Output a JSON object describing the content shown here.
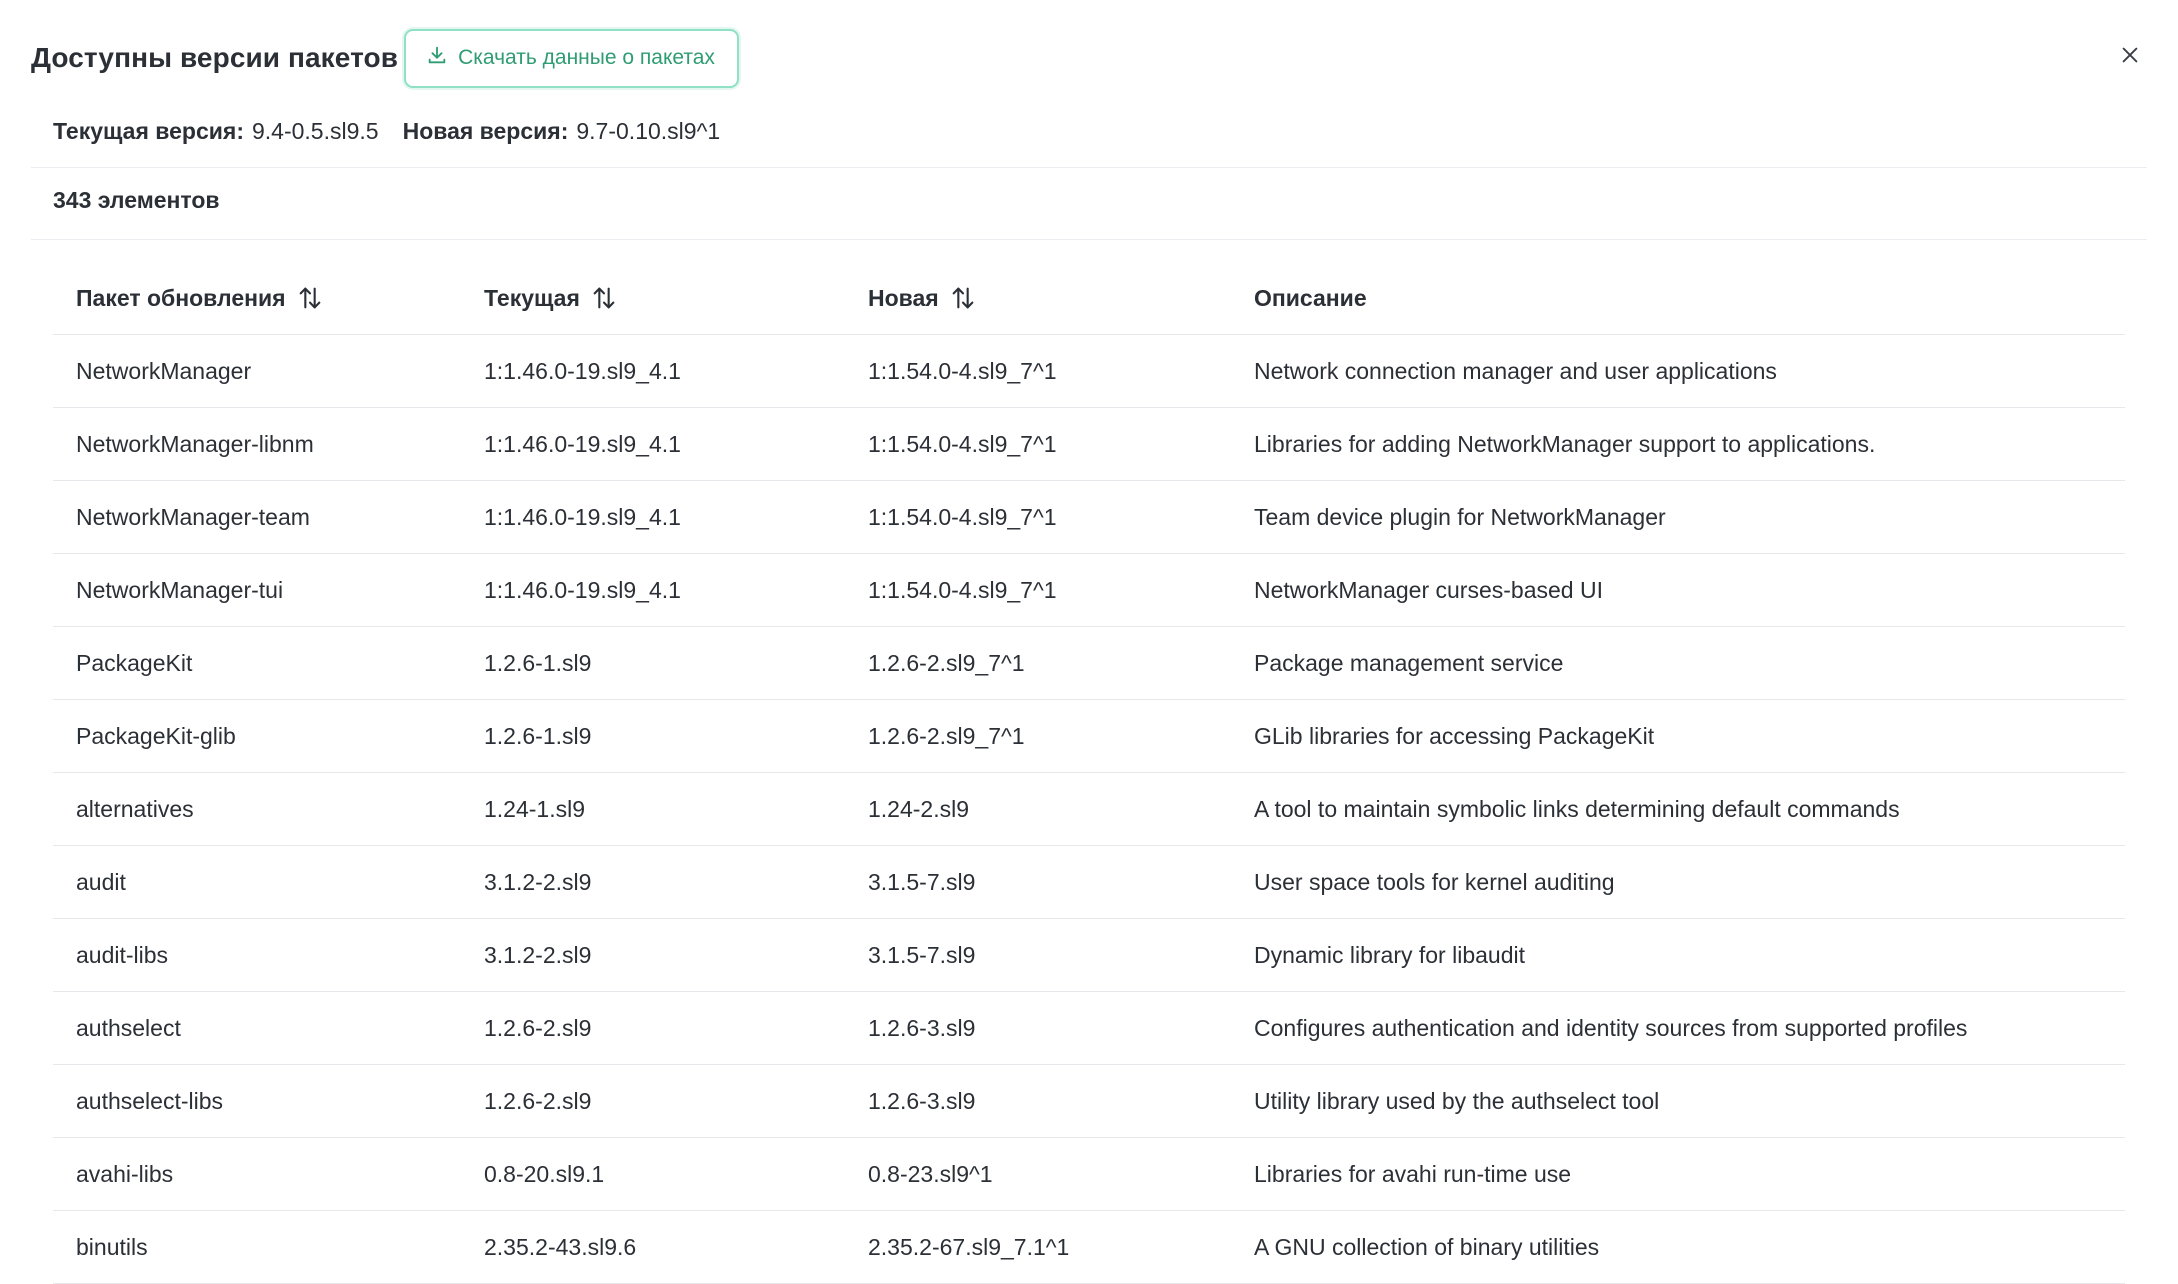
{
  "header": {
    "title": "Доступны версии пакетов",
    "download_label": "Скачать данные о пакетах"
  },
  "versions": {
    "current_label": "Текущая версия:",
    "current_value": "9.4-0.5.sl9.5",
    "new_label": "Новая версия:",
    "new_value": "9.7-0.10.sl9^1"
  },
  "count_label": "343 элементов",
  "table": {
    "columns": [
      "Пакет обновления",
      "Текущая",
      "Новая",
      "Описание"
    ],
    "rows": [
      [
        "NetworkManager",
        "1:1.46.0-19.sl9_4.1",
        "1:1.54.0-4.sl9_7^1",
        "Network connection manager and user applications"
      ],
      [
        "NetworkManager-libnm",
        "1:1.46.0-19.sl9_4.1",
        "1:1.54.0-4.sl9_7^1",
        "Libraries for adding NetworkManager support to applications."
      ],
      [
        "NetworkManager-team",
        "1:1.46.0-19.sl9_4.1",
        "1:1.54.0-4.sl9_7^1",
        "Team device plugin for NetworkManager"
      ],
      [
        "NetworkManager-tui",
        "1:1.46.0-19.sl9_4.1",
        "1:1.54.0-4.sl9_7^1",
        "NetworkManager curses-based UI"
      ],
      [
        "PackageKit",
        "1.2.6-1.sl9",
        "1.2.6-2.sl9_7^1",
        "Package management service"
      ],
      [
        "PackageKit-glib",
        "1.2.6-1.sl9",
        "1.2.6-2.sl9_7^1",
        "GLib libraries for accessing PackageKit"
      ],
      [
        "alternatives",
        "1.24-1.sl9",
        "1.24-2.sl9",
        "A tool to maintain symbolic links determining default commands"
      ],
      [
        "audit",
        "3.1.2-2.sl9",
        "3.1.5-7.sl9",
        "User space tools for kernel auditing"
      ],
      [
        "audit-libs",
        "3.1.2-2.sl9",
        "3.1.5-7.sl9",
        "Dynamic library for libaudit"
      ],
      [
        "authselect",
        "1.2.6-2.sl9",
        "1.2.6-3.sl9",
        "Configures authentication and identity sources from supported profiles"
      ],
      [
        "authselect-libs",
        "1.2.6-2.sl9",
        "1.2.6-3.sl9",
        "Utility library used by the authselect tool"
      ],
      [
        "avahi-libs",
        "0.8-20.sl9.1",
        "0.8-23.sl9^1",
        "Libraries for avahi run-time use"
      ],
      [
        "binutils",
        "2.35.2-43.sl9.6",
        "2.35.2-67.sl9_7.1^1",
        "A GNU collection of binary utilities"
      ]
    ]
  },
  "colors": {
    "accent": "#2f9c73",
    "accent_border": "#8fe0c5",
    "text": "#2b2f36",
    "divider": "#e6e8eb"
  },
  "icons": {
    "download": "download-icon",
    "close": "close-icon",
    "sort": "sort-icon"
  }
}
